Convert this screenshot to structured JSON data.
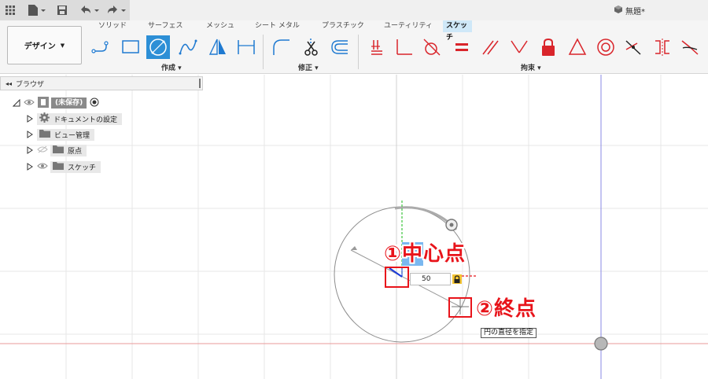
{
  "app": {
    "doc_title": "無題*"
  },
  "ribbon": {
    "workspace_label": "デザイン",
    "tabs": [
      "ソリッド",
      "サーフェス",
      "メッシュ",
      "シート メタル",
      "プラスチック",
      "ユーティリティ",
      "スケッチ"
    ],
    "active_tab": "スケッチ",
    "groups": {
      "create": "作成 ▾",
      "modify": "修正 ▾",
      "constraints": "拘束 ▾"
    }
  },
  "browser": {
    "title": "ブラウザ",
    "root_label": "(未保存)",
    "items": [
      {
        "label": "ドキュメントの設定",
        "icon": "gear-icon"
      },
      {
        "label": "ビュー管理",
        "icon": "folder-icon"
      },
      {
        "label": "原点",
        "icon": "folder-icon"
      },
      {
        "label": "スケッチ",
        "icon": "folder-icon"
      }
    ]
  },
  "canvas": {
    "dimension_value": "50",
    "tooltip": "円の直径を指定"
  },
  "annotations": {
    "center_num": "①",
    "center_hl": "中",
    "center_rest": "心点",
    "end_num": "②",
    "end_text": "終点"
  },
  "colors": {
    "accent": "#2d8fd6",
    "annotation_red": "#e8141b",
    "constraint_red": "#d9252b",
    "x_axis": "#e07070",
    "y_axis": "#3ec43e",
    "blue_axis": "#8080e0"
  }
}
